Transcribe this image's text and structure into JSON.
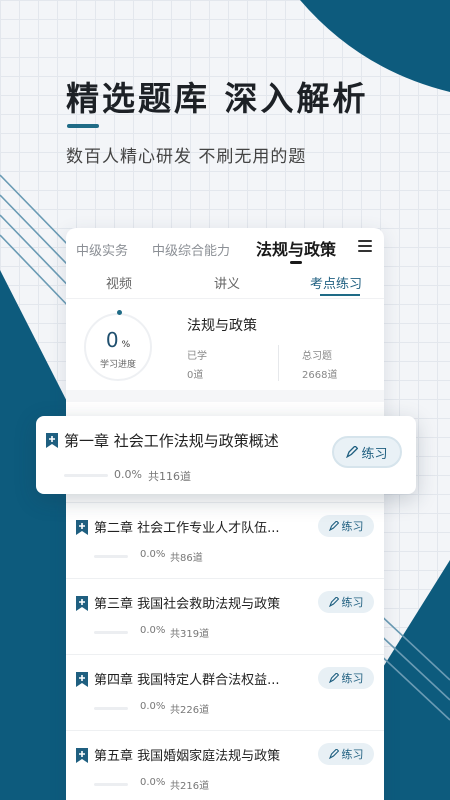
{
  "hero": {
    "title": "精选题库  深入解析",
    "subtitle": "数百人精心研发  不刷无用的题"
  },
  "tabs": [
    {
      "label": "中级实务"
    },
    {
      "label": "中级综合能力"
    },
    {
      "label": "法规与政策",
      "active": true
    }
  ],
  "subtabs": [
    {
      "label": "视频"
    },
    {
      "label": "讲义"
    },
    {
      "label": "考点练习",
      "active": true
    }
  ],
  "stats": {
    "progress_value": "0",
    "progress_unit": "%",
    "progress_label": "学习进度",
    "subject": "法规与政策",
    "learned_label": "已学",
    "learned_value": "0道",
    "total_label": "总习题",
    "total_value": "2668道"
  },
  "practice_label": "练习",
  "popup_chapter": {
    "title": "第一章 社会工作法规与政策概述",
    "progress": "0.0%",
    "count": "共116道"
  },
  "chapters": [
    {
      "title": "第二章 社会工作专业人才队伍...",
      "progress": "0.0%",
      "count": "共86道"
    },
    {
      "title": "第三章 我国社会救助法规与政策",
      "progress": "0.0%",
      "count": "共319道"
    },
    {
      "title": "第四章 我国特定人群合法权益...",
      "progress": "0.0%",
      "count": "共226道"
    },
    {
      "title": "第五章 我国婚姻家庭法规与政策",
      "progress": "0.0%",
      "count": "共216道"
    }
  ],
  "colors": {
    "accent": "#1f6b86",
    "dark_teal": "#0d5b7d"
  }
}
